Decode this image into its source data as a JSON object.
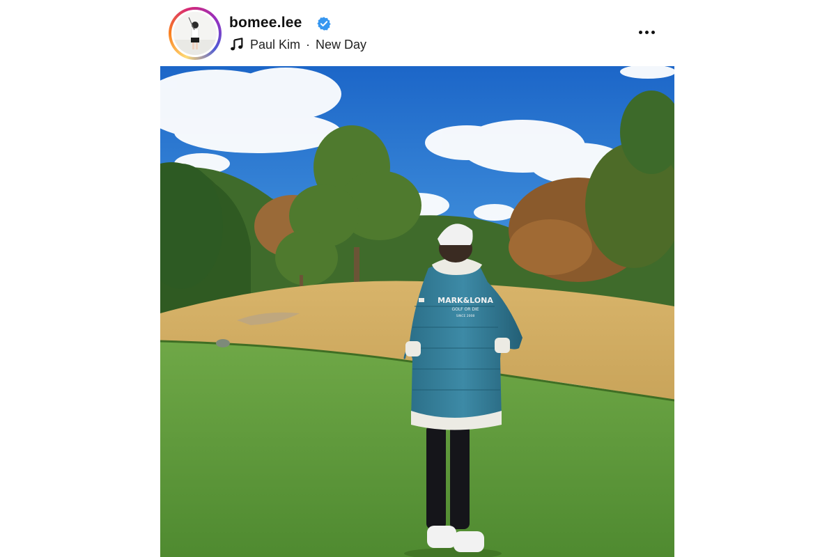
{
  "post": {
    "username": "bomee.lee",
    "verified": true,
    "music": {
      "artist": "Paul Kim",
      "separator": "·",
      "song": "New Day"
    },
    "icons": {
      "verified": "verified-badge-icon",
      "music": "music-note-icon",
      "more": "more-options-icon"
    },
    "photo": {
      "jacket_text_line1": "MARK&LONA",
      "jacket_text_line2": "GOLF OR DIE",
      "jacket_text_line3": "SINCE 2008"
    }
  },
  "colors": {
    "verified_blue": "#3797f0",
    "sky_top": "#1f6fd0",
    "grass": "#5d9a3a",
    "jacket": "#2f7a93"
  }
}
